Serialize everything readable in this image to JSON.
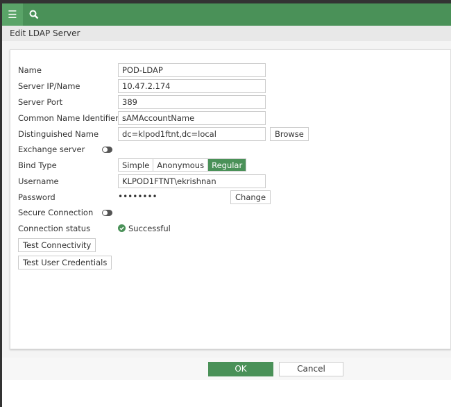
{
  "header": {
    "title": "Edit LDAP Server"
  },
  "form": {
    "name_label": "Name",
    "name_value": "POD-LDAP",
    "server_label": "Server IP/Name",
    "server_value": "10.47.2.174",
    "port_label": "Server Port",
    "port_value": "389",
    "cn_label": "Common Name Identifier",
    "cn_value": "sAMAccountName",
    "dn_label": "Distinguished Name",
    "dn_value": "dc=klpod1ftnt,dc=local",
    "browse": "Browse",
    "exchange_label": "Exchange server",
    "bind_label": "Bind Type",
    "bind_options": [
      "Simple",
      "Anonymous",
      "Regular"
    ],
    "username_label": "Username",
    "username_value": "KLPOD1FTNT\\ekrishnan",
    "password_label": "Password",
    "password_value": "••••••••",
    "change": "Change",
    "secure_label": "Secure Connection",
    "status_label": "Connection status",
    "status_value": "Successful",
    "test_connectivity": "Test Connectivity",
    "test_credentials": "Test User Credentials"
  },
  "footer": {
    "ok": "OK",
    "cancel": "Cancel"
  },
  "colors": {
    "accent": "#4a9158"
  }
}
